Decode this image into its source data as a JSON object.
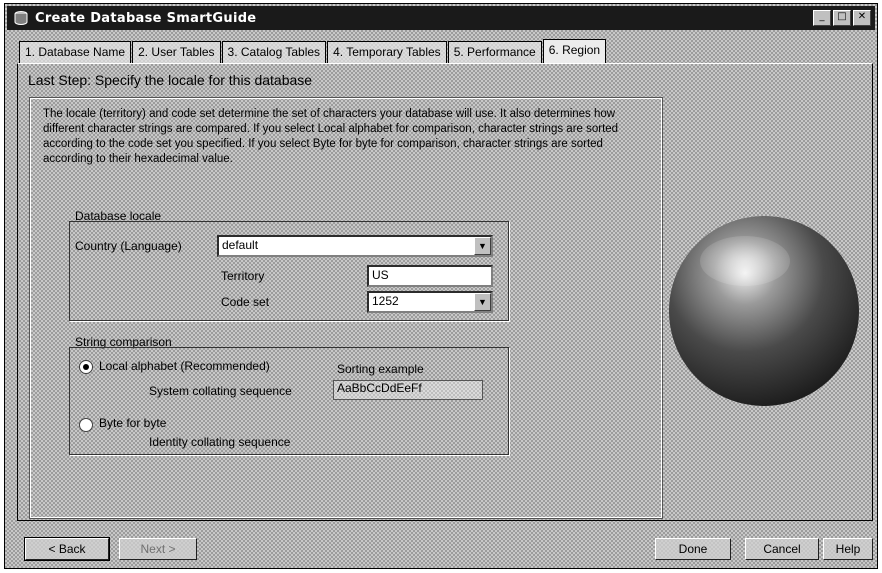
{
  "window": {
    "title": "Create Database SmartGuide",
    "caption_buttons": {
      "minimize": "_",
      "maximize": "□",
      "close": "✕"
    }
  },
  "tabs": [
    {
      "label": "1. Database Name"
    },
    {
      "label": "2. User Tables"
    },
    {
      "label": "3. Catalog Tables"
    },
    {
      "label": "4. Temporary Tables"
    },
    {
      "label": "5. Performance"
    },
    {
      "label": "6. Region"
    }
  ],
  "active_tab": "6. Region",
  "main": {
    "heading": "Last Step: Specify the locale for this database",
    "description": "The locale (territory) and code set determine the set of characters your database will use. It also determines how different character strings are compared. If you select Local alphabet for comparison, character strings are sorted according to the code set you specified. If you select Byte for byte for comparison, character strings are sorted according to their hexadecimal value.",
    "database_locale": {
      "group_label": "Database locale",
      "country_label": "Country (Language)",
      "country_value": "default",
      "territory_label": "Territory",
      "territory_value": "US",
      "codeset_label": "Code set",
      "codeset_value": "1252"
    },
    "string_comparison": {
      "group_label": "String comparison",
      "local_alphabet_label": "Local alphabet (Recommended)",
      "sorting_example_label": "Sorting example",
      "system_collating_label": "System collating sequence",
      "system_collating_value": "AaBbCcDdEeFf",
      "byte_for_byte_label": "Byte for byte",
      "identity_collating_label": "Identity collating sequence",
      "selected": "local_alphabet"
    }
  },
  "buttons": {
    "back": "< Back",
    "next": "Next >",
    "done": "Done",
    "cancel": "Cancel",
    "help": "Help"
  }
}
